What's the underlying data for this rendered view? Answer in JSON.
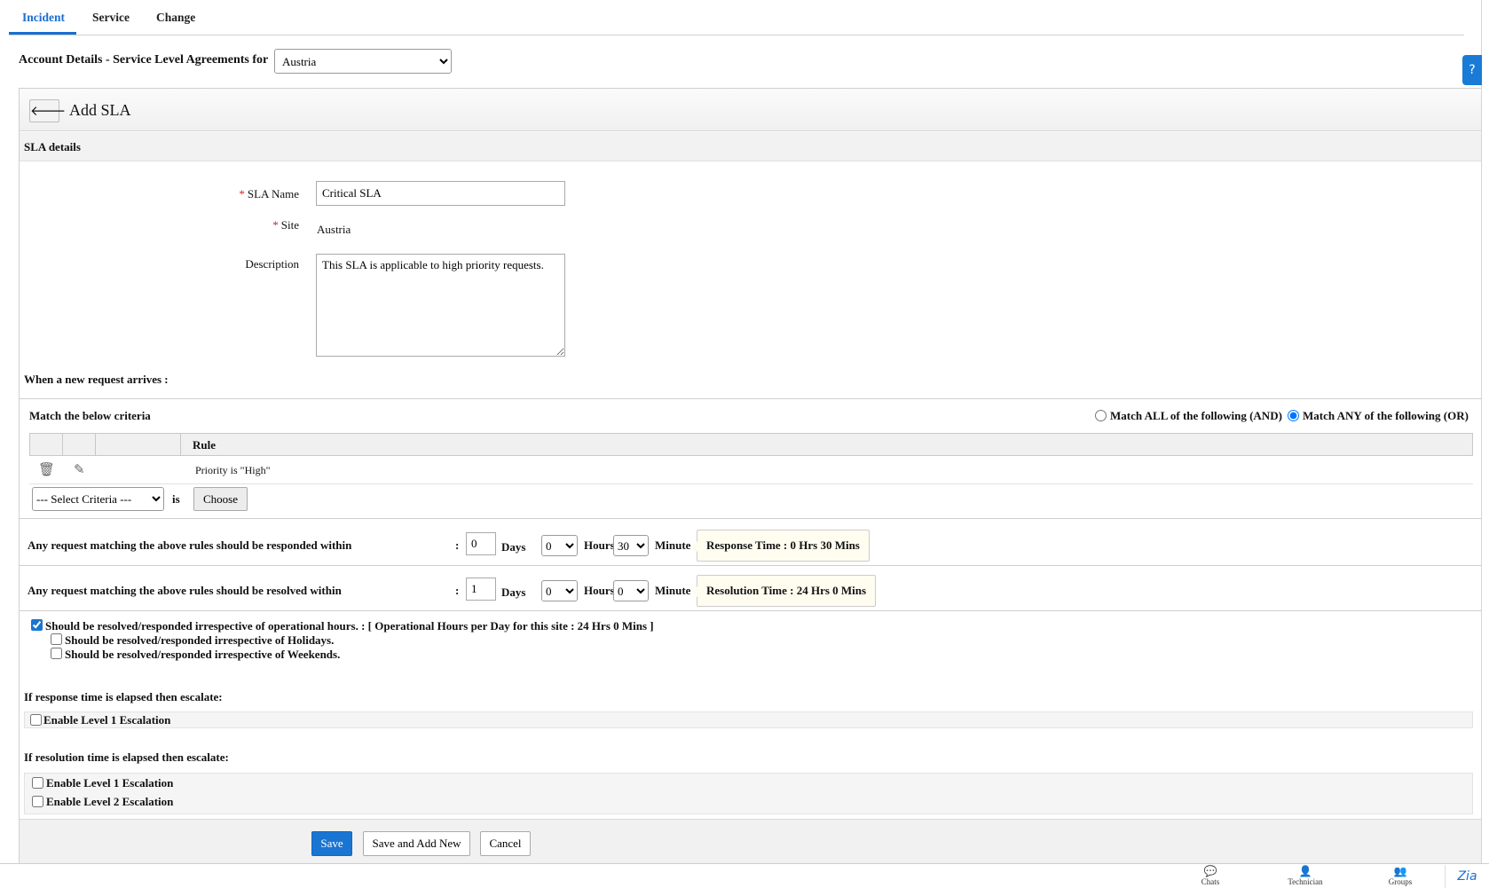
{
  "tabs": [
    {
      "label": "Incident",
      "active": true
    },
    {
      "label": "Service",
      "active": false
    },
    {
      "label": "Change",
      "active": false
    }
  ],
  "account": {
    "label": "Account Details - Service Level Agreements for",
    "selected": "Austria"
  },
  "help": {
    "icon": "help-icon",
    "glyph": "?"
  },
  "page": {
    "back_icon": "arrow-left-icon",
    "back_glyph": "🡐",
    "title": "Add SLA",
    "section": "SLA details"
  },
  "form": {
    "required_mark": "*",
    "sla_name_label": "SLA Name",
    "sla_name_value": "Critical SLA",
    "site_label": "Site",
    "site_value": "Austria",
    "description_label": "Description",
    "description_value": "This SLA is applicable to high priority requests."
  },
  "criteria": {
    "heading": "When a new request arrives :",
    "match_label": "Match the below criteria",
    "match_all_label": "Match ALL of the following (AND)",
    "match_any_label": "Match ANY of the following (OR)",
    "selected_match": "any",
    "column_rule": "Rule",
    "rows": [
      {
        "delete_icon": "trash-icon",
        "edit_icon": "pencil-icon",
        "rule": "Priority is \"High\""
      }
    ],
    "select_placeholder": "--- Select Criteria ---",
    "is_label": "is",
    "choose_button": "Choose"
  },
  "response": {
    "label": "Any request matching the above rules should be responded within",
    "colon": ":",
    "days": "0",
    "days_label": "Days",
    "hours": "0",
    "hours_label": "Hours",
    "minutes": "30",
    "minutes_label": "Minute",
    "summary": "Response Time : 0 Hrs 30 Mins"
  },
  "resolution": {
    "label": "Any request matching the above rules should be resolved within",
    "colon": ":",
    "days": "1",
    "days_label": "Days",
    "hours": "0",
    "hours_label": "Hours",
    "minutes": "0",
    "minutes_label": "Minute",
    "summary": "Resolution Time : 24 Hrs 0 Mins"
  },
  "operational": {
    "irrespective_label": "Should be resolved/responded irrespective of operational hours. : [ Operational Hours per Day for this site :  24 Hrs 0 Mins ]",
    "irrespective_checked": true,
    "holidays_label": "Should be resolved/responded irrespective of Holidays.",
    "holidays_checked": false,
    "weekends_label": "Should be resolved/responded irrespective of Weekends.",
    "weekends_checked": false
  },
  "escalation": {
    "response_heading": "If response time is elapsed then escalate:",
    "response_level1": "Enable Level 1 Escalation",
    "resolution_heading": "If resolution time is elapsed then escalate:",
    "resolution_level1": "Enable Level 1 Escalation",
    "resolution_level2": "Enable Level 2 Escalation"
  },
  "actions": {
    "save": "Save",
    "save_add_new": "Save and Add New",
    "cancel": "Cancel"
  },
  "bottom_bar": [
    {
      "label": "Chats",
      "icon": "chat-icon"
    },
    {
      "label": "Technician",
      "icon": "user-icon"
    },
    {
      "label": "Groups",
      "icon": "groups-icon"
    }
  ],
  "zia": {
    "label": "Zia",
    "icon": "zia-icon"
  },
  "colors": {
    "accent": "#1a75d2",
    "required": "#d22222"
  }
}
